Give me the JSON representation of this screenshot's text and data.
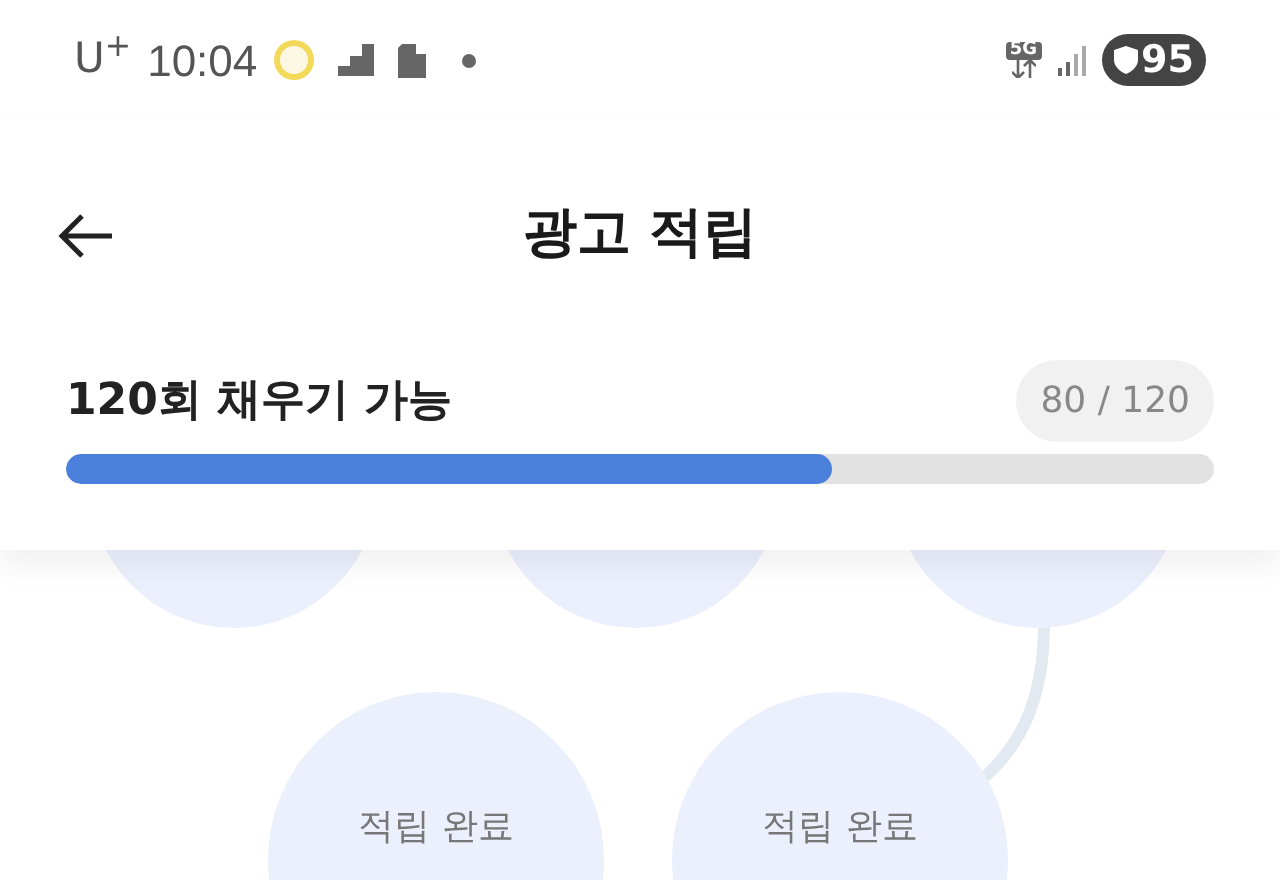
{
  "status_bar": {
    "carrier": "U$^{+}$",
    "time": "10:04",
    "network": "5G",
    "battery": "95"
  },
  "header": {
    "title": "광고 적립"
  },
  "progress": {
    "label": "120회 채우기 가능",
    "count": "80 / 120",
    "level": 0.667
  },
  "nodes": [
    {
      "label": "적립 완료"
    },
    {
      "label": "적립 완료"
    }
  ]
}
